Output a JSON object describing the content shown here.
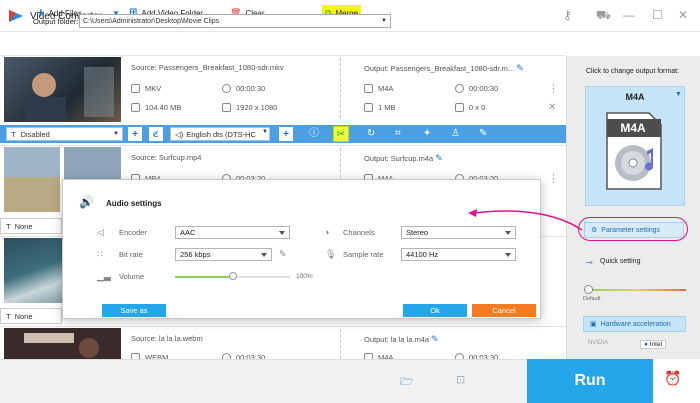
{
  "app": {
    "title": "Video Converter"
  },
  "toolbar": {
    "add_files": "Add Files",
    "add_video_folder": "Add Video Folder",
    "clear": "Clear",
    "merge": "Merge"
  },
  "files": [
    {
      "source": "Source: Passengers_Breakfast_1080-sdr.mkv",
      "format": "MKV",
      "duration": "00:00:30",
      "size": "104.40 MB",
      "resolution": "1920 x 1080",
      "output": "Output: Passengers_Breakfast_1080-sdr.m...",
      "out_format": "M4A",
      "out_duration": "00:00:30",
      "out_size": "1 MB",
      "out_resolution": "0 x 0"
    },
    {
      "source": "Source: Surfcup.mp4",
      "format": "MP4",
      "duration": "00:03:20",
      "output": "Output: Surfcup.m4a",
      "out_format": "M4A",
      "out_duration": "00:03:20"
    },
    {
      "source": "Source: la la la.webm",
      "format": "WEBM",
      "duration": "00:03:30",
      "output": "Output: la la la.m4a",
      "out_format": "M4A",
      "out_duration": "00:03:30"
    }
  ],
  "control_strip": {
    "subtitle": "Disabled",
    "audio_track": "English dts (DTS-HC"
  },
  "subtitle_none": "None",
  "audio_dialog": {
    "title": "Audio settings",
    "encoder_label": "Encoder",
    "encoder_value": "AAC",
    "bitrate_label": "Bit rate",
    "bitrate_value": "256 kbps",
    "volume_label": "Volume",
    "volume_value": "100%",
    "volume_level": 0.5,
    "channels_label": "Channels",
    "channels_value": "Stereo",
    "samplerate_label": "Sample rate",
    "samplerate_value": "44100 Hz",
    "save_as": "Save as",
    "ok": "Ok",
    "cancel": "Cancel"
  },
  "right_panel": {
    "caption": "Click to change output format:",
    "format": "M4A",
    "parameter_settings": "Parameter settings",
    "quick_setting": "Quick setting",
    "default_label": "Default",
    "hardware_acceleration": "Hardware acceleration",
    "nvidia": "NVIDIA",
    "intel": "Intel"
  },
  "bottom": {
    "output_folder_label": "Output folder:",
    "output_folder_path": "C:\\Users\\Administrator\\Desktop\\Movie Clips",
    "run": "Run"
  },
  "colors": {
    "accent": "#25a6ea",
    "strip": "#4aa0e2",
    "highlight": "#f5f51c",
    "annotation": "#e0108e",
    "cancel": "#f47b20"
  }
}
